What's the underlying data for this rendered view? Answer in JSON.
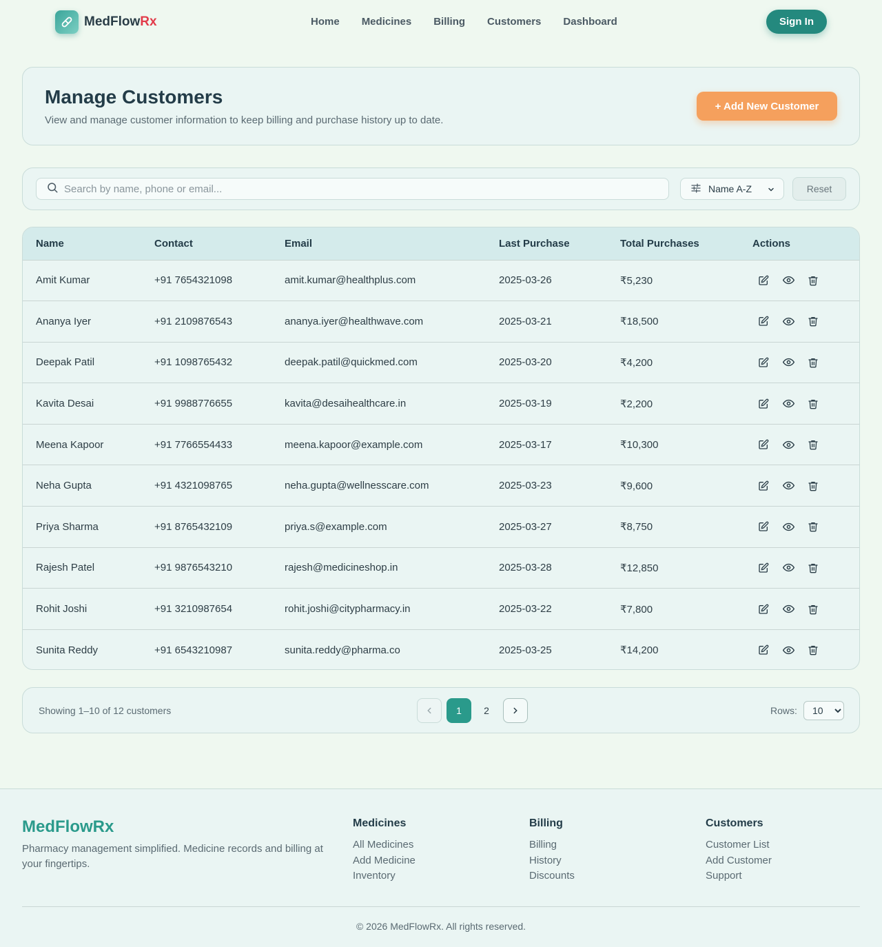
{
  "brand": {
    "name": "MedFlow",
    "suffix": "Rx",
    "icon": "pill-icon",
    "accent": "#2a9a8b",
    "rx_color": "#e23b4a"
  },
  "nav": {
    "items": [
      "Home",
      "Medicines",
      "Billing",
      "Customers",
      "Dashboard"
    ],
    "signin_label": "Sign In"
  },
  "hero": {
    "title": "Manage Customers",
    "subtitle": "View and manage customer information to keep billing and purchase history up to date.",
    "add_label": "+ Add New Customer"
  },
  "filters": {
    "search_placeholder": "Search by name, phone or email...",
    "search_value": "",
    "sort_value": "Name A-Z",
    "reset_label": "Reset"
  },
  "table": {
    "columns": [
      "Name",
      "Contact",
      "Email",
      "Last Purchase",
      "Total Purchases",
      "Actions"
    ],
    "rows": [
      [
        "Amit Kumar",
        "+91 7654321098",
        "amit.kumar@healthplus.com",
        "2025-03-26",
        "₹5,230"
      ],
      [
        "Ananya Iyer",
        "+91 2109876543",
        "ananya.iyer@healthwave.com",
        "2025-03-21",
        "₹18,500"
      ],
      [
        "Deepak Patil",
        "+91 1098765432",
        "deepak.patil@quickmed.com",
        "2025-03-20",
        "₹4,200"
      ],
      [
        "Kavita Desai",
        "+91 9988776655",
        "kavita@desaihealthcare.in",
        "2025-03-19",
        "₹2,200"
      ],
      [
        "Meena Kapoor",
        "+91 7766554433",
        "meena.kapoor@example.com",
        "2025-03-17",
        "₹10,300"
      ],
      [
        "Neha Gupta",
        "+91 4321098765",
        "neha.gupta@wellnesscare.com",
        "2025-03-23",
        "₹9,600"
      ],
      [
        "Priya Sharma",
        "+91 8765432109",
        "priya.s@example.com",
        "2025-03-27",
        "₹8,750"
      ],
      [
        "Rajesh Patel",
        "+91 9876543210",
        "rajesh@medicineshop.in",
        "2025-03-28",
        "₹12,850"
      ],
      [
        "Rohit Joshi",
        "+91 3210987654",
        "rohit.joshi@citypharmacy.in",
        "2025-03-22",
        "₹7,800"
      ],
      [
        "Sunita Reddy",
        "+91 6543210987",
        "sunita.reddy@pharma.co",
        "2025-03-25",
        "₹14,200"
      ]
    ],
    "action_icons": [
      "edit-icon",
      "eye-icon",
      "trash-icon"
    ]
  },
  "pagination": {
    "showing": "Showing 1–10 of 12 customers",
    "pages": [
      "1",
      "2"
    ],
    "current": "1",
    "rows_label": "Rows:",
    "rows_value": "10"
  },
  "footer": {
    "brand": "MedFlowRx",
    "description": "Pharmacy management simplified. Medicine records and billing at your fingertips.",
    "columns": [
      {
        "title": "Medicines",
        "links": [
          "All Medicines",
          "Add Medicine",
          "Inventory"
        ]
      },
      {
        "title": "Billing",
        "links": [
          "Billing",
          "History",
          "Discounts"
        ]
      },
      {
        "title": "Customers",
        "links": [
          "Customer List",
          "Add Customer",
          "Support"
        ]
      }
    ],
    "copyright": "© 2026 MedFlowRx. All rights reserved."
  }
}
